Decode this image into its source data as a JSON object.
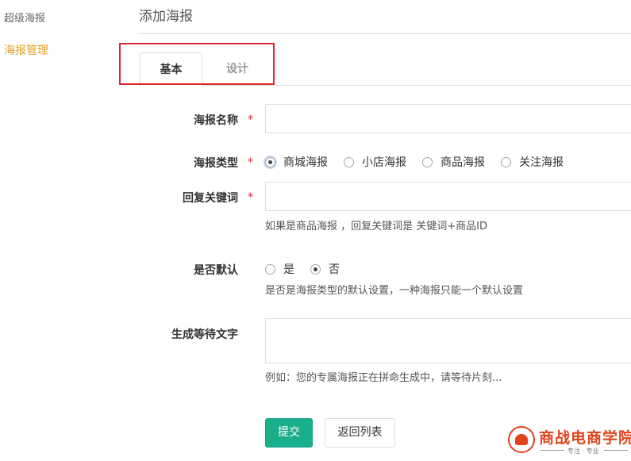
{
  "sidebar": {
    "title": "超级海报",
    "items": [
      {
        "label": "海报管理"
      }
    ]
  },
  "header": {
    "title": "添加海报"
  },
  "tabs": [
    {
      "label": "基本",
      "active": true
    },
    {
      "label": "设计",
      "active": false
    }
  ],
  "form": {
    "name": {
      "label": "海报名称",
      "required": "*",
      "value": ""
    },
    "type": {
      "label": "海报类型",
      "required": "*",
      "options": [
        "商城海报",
        "小店海报",
        "商品海报",
        "关注海报"
      ],
      "selected": "商城海报"
    },
    "keyword": {
      "label": "回复关键词",
      "required": "*",
      "value": "",
      "help": "如果是商品海报 ，回复关键词是 关键词+商品ID"
    },
    "is_default": {
      "label": "是否默认",
      "options": [
        "是",
        "否"
      ],
      "selected": "否",
      "help": "是否是海报类型的默认设置，一种海报只能一个默认设置"
    },
    "wait_text": {
      "label": "生成等待文字",
      "value": "",
      "help": "例如：您的专属海报正在拼命生成中，请等待片刻..."
    }
  },
  "actions": {
    "submit_label": "提交",
    "back_label": "返回列表"
  },
  "watermark": {
    "name": "商战电商学院",
    "tagline": "专注 · 专业"
  },
  "colors": {
    "accent": "#1aaf8c",
    "sidebar_active": "#e4a01f",
    "required": "#e0282e",
    "highlight_box": "#e0282e",
    "watermark": "#e0431a"
  }
}
